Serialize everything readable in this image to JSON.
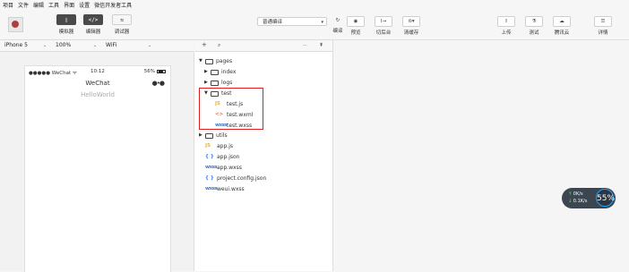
{
  "menu": [
    "项目",
    "文件",
    "编辑",
    "工具",
    "界面",
    "设置",
    "微信开发者工具"
  ],
  "toolbar": {
    "simulator_label": "模拟器",
    "editor_label": "编辑器",
    "debugger_label": "调试器",
    "compile_mode": "普通编译",
    "compile_label": "编译",
    "preview_label": "预览",
    "background_label": "切后台",
    "clear_cache_label": "清缓存",
    "upload_label": "上传",
    "test_label": "测试",
    "tencent_cloud_label": "腾讯云",
    "details_label": "详情"
  },
  "device_bar": {
    "device": "iPhone 5",
    "zoom": "100%",
    "network": "WiFi"
  },
  "phone": {
    "signal": "●●●●● WeChat ᯤ",
    "time": "10:12",
    "battery": "56%",
    "nav_title": "WeChat",
    "content": "HelloWorld"
  },
  "file_toolbar": {
    "add": "+",
    "search": "⌕",
    "more": "···",
    "collapse": "⇞"
  },
  "file_tree": [
    {
      "name": "pages",
      "type": "folder",
      "expanded": true
    },
    {
      "name": "index",
      "type": "folder",
      "expanded": false
    },
    {
      "name": "logs",
      "type": "folder",
      "expanded": false
    },
    {
      "name": "test",
      "type": "folder",
      "expanded": true
    },
    {
      "name": "test.js",
      "type": "js",
      "icon": "JS"
    },
    {
      "name": "test.wxml",
      "type": "wxml",
      "icon": "<>"
    },
    {
      "name": "test.wxss",
      "type": "wxss",
      "icon": "wxss"
    },
    {
      "name": "utils",
      "type": "folder",
      "expanded": false
    },
    {
      "name": "app.js",
      "type": "js",
      "icon": "JS"
    },
    {
      "name": "app.json",
      "type": "json",
      "icon": "{ }"
    },
    {
      "name": "app.wxss",
      "type": "wxss",
      "icon": "wxss"
    },
    {
      "name": "project.config.json",
      "type": "json",
      "icon": "{ }"
    },
    {
      "name": "weui.wxss",
      "type": "wxss",
      "icon": "wxss"
    }
  ],
  "net_widget": {
    "up": "0K/s",
    "down": "0.1K/s",
    "percent": "55%"
  },
  "colors": {
    "highlight": "#e02020",
    "accent": "#1aa3ff"
  }
}
